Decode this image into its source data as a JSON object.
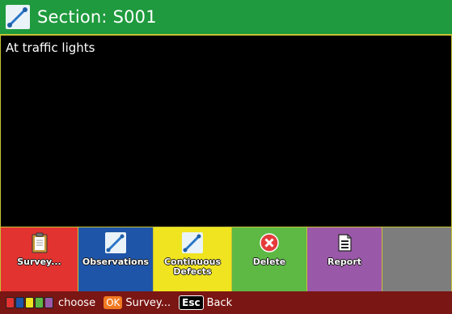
{
  "header": {
    "title": "Section: S001",
    "icon": "pencil-icon",
    "color": "#1f9a3e"
  },
  "content": {
    "text": "At traffic lights"
  },
  "buttons": [
    {
      "label_1": "Survey...",
      "label_2": "",
      "icon": "clipboard-icon",
      "color": "#e23331"
    },
    {
      "label_1": "Observations",
      "label_2": "",
      "icon": "pencil-icon",
      "color": "#1f55a8"
    },
    {
      "label_1": "Continuous",
      "label_2": "Defects",
      "icon": "pencil-icon",
      "color": "#efe41f"
    },
    {
      "label_1": "Delete",
      "label_2": "",
      "icon": "close-circle-icon",
      "color": "#5db944"
    },
    {
      "label_1": "Report",
      "label_2": "",
      "icon": "document-icon",
      "color": "#9a58a8"
    },
    {
      "label_1": "",
      "label_2": "",
      "icon": "",
      "color": "#7d7d7d"
    }
  ],
  "footer": {
    "color_keys": [
      "#e23331",
      "#1f55a8",
      "#efe41f",
      "#5db944",
      "#9a58a8"
    ],
    "choose_label": "choose",
    "ok_key": "OK",
    "ok_label": "Survey...",
    "esc_key": "Esc",
    "esc_label": "Back",
    "color": "#7a1613"
  }
}
